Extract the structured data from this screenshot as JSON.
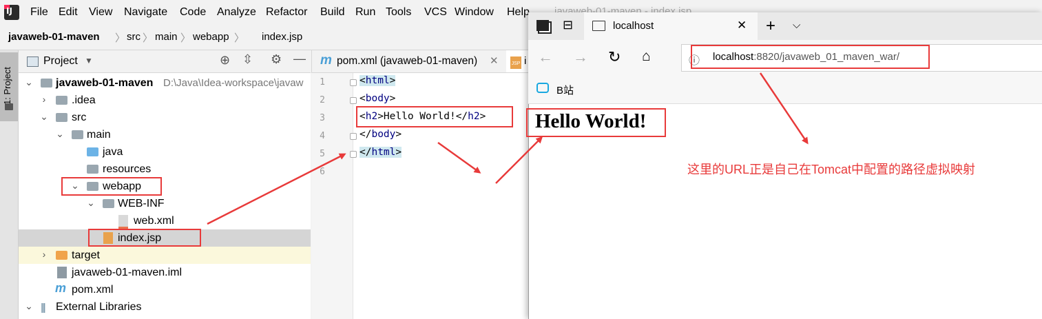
{
  "menu": [
    "File",
    "Edit",
    "View",
    "Navigate",
    "Code",
    "Analyze",
    "Refactor",
    "Build",
    "Run",
    "Tools",
    "VCS",
    "Window",
    "Help"
  ],
  "window_title": "javaweb-01-maven - index.jsp",
  "breadcrumb": [
    "javaweb-01-maven",
    "src",
    "main",
    "webapp",
    "index.jsp"
  ],
  "tool_strip": {
    "project_tab": "1: Project"
  },
  "project_panel": {
    "title": "Project",
    "tree": [
      {
        "label": "javaweb-01-maven",
        "path": "D:\\Java\\Idea-workspace\\javaw"
      },
      {
        "label": ".idea"
      },
      {
        "label": "src"
      },
      {
        "label": "main"
      },
      {
        "label": "java"
      },
      {
        "label": "resources"
      },
      {
        "label": "webapp"
      },
      {
        "label": "WEB-INF"
      },
      {
        "label": "web.xml"
      },
      {
        "label": "index.jsp"
      },
      {
        "label": "target"
      },
      {
        "label": "javaweb-01-maven.iml"
      },
      {
        "label": "pom.xml"
      },
      {
        "label": "External Libraries"
      }
    ]
  },
  "editor": {
    "tabs": [
      {
        "label": "pom.xml (javaweb-01-maven)"
      },
      {
        "label": "i"
      }
    ],
    "line_numbers": [
      "1",
      "2",
      "3",
      "4",
      "5",
      "6"
    ],
    "lines": [
      {
        "open": "<",
        "tag": "html",
        "close": ">"
      },
      {
        "open": "<",
        "tag": "body",
        "close": ">"
      },
      {
        "open": "<",
        "tag": "h2",
        "mid": ">Hello World!</",
        "tag2": "h2",
        "close": ">"
      },
      {
        "open": "</",
        "tag": "body",
        "close": ">"
      },
      {
        "open": "</",
        "tag": "html",
        "close": ">"
      }
    ],
    "file_icon_label": "JSP"
  },
  "browser": {
    "tab_title": "localhost",
    "address_host": "localhost",
    "address_path": ":8820/javaweb_01_maven_war/",
    "favorite": "B站",
    "page_heading": "Hello World!"
  },
  "annotation": "这里的URL正是自己在Tomcat中配置的路径虚拟映射",
  "colors": {
    "accent_red": "#e83a3a",
    "tag_blue": "#000080",
    "folder_gray": "#9aa7b0",
    "folder_blue": "#6cb3e6",
    "folder_orange": "#f0a44b"
  }
}
